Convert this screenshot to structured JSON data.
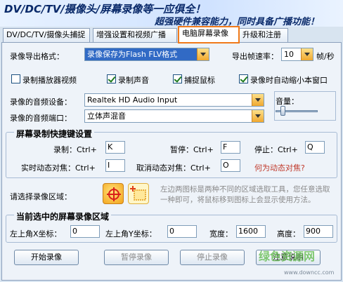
{
  "banner": {
    "title": "DV/DC/TV/摄像头/屏幕录像等一应俱全！",
    "tagline": "超强硬件兼容能力，同时具备广播功能！"
  },
  "tabs": [
    {
      "label": "DV/DC/TV/摄像头捕捉"
    },
    {
      "label": "增强设置和视频广播"
    },
    {
      "label": "电脑屏幕录像"
    },
    {
      "label": "升级和注册"
    }
  ],
  "format": {
    "label": "录像导出格式：",
    "value": "录像保存为Flash FLV格式"
  },
  "fps": {
    "label": "导出帧速率：",
    "value": "10",
    "unit": "帧/秒"
  },
  "checkboxes": [
    {
      "label": "录制播放器视频",
      "checked": false
    },
    {
      "label": "录制声音",
      "checked": true
    },
    {
      "label": "捕捉鼠标",
      "checked": true
    },
    {
      "label": "录像时自动缩小本窗口",
      "checked": true
    }
  ],
  "audio_device": {
    "label": "录像的音频设备：",
    "value": "Realtek HD Audio Input"
  },
  "audio_port": {
    "label": "录像的音频端口：",
    "value": "立体声混音"
  },
  "volume": {
    "label": "音量：",
    "level": 0.1
  },
  "hotkeys": {
    "title": "屏幕录制快捷键设置",
    "record": {
      "label": "录制：Ctrl+",
      "key": "K"
    },
    "pause": {
      "label": "暂停：Ctrl+",
      "key": "F"
    },
    "stop": {
      "label": "停止：Ctrl+",
      "key": "Q"
    },
    "focus": {
      "label": "实时动态对焦：Ctrl+",
      "key": "I"
    },
    "cancel_focus": {
      "label": "取消动态对焦：Ctrl+",
      "key": "O"
    },
    "what_link": "何为动态对焦?"
  },
  "region": {
    "label": "请选择录像区域：",
    "hint": "左边两图标是两种不同的区域选取工具，您任意选取一种即可，将鼠标移到图标上会显示使用方法。"
  },
  "current_region": {
    "title": "当前选中的屏幕录像区域",
    "x_label": "左上角X坐标：",
    "x": "0",
    "y_label": "左上角Y坐标：",
    "y": "0",
    "w_label": "宽度：",
    "w": "1600",
    "h_label": "高度：",
    "h": "900"
  },
  "buttons": {
    "start": "开始录像",
    "pause": "暂停录像",
    "stop": "停止录像",
    "notes": "注意说明"
  },
  "watermark": {
    "cn": "绿色资源网",
    "url": "www.downcc.com"
  },
  "colors": {
    "accent_orange": "#f07a1a",
    "selection_blue": "#316ac5",
    "link_red": "#c0392b"
  }
}
